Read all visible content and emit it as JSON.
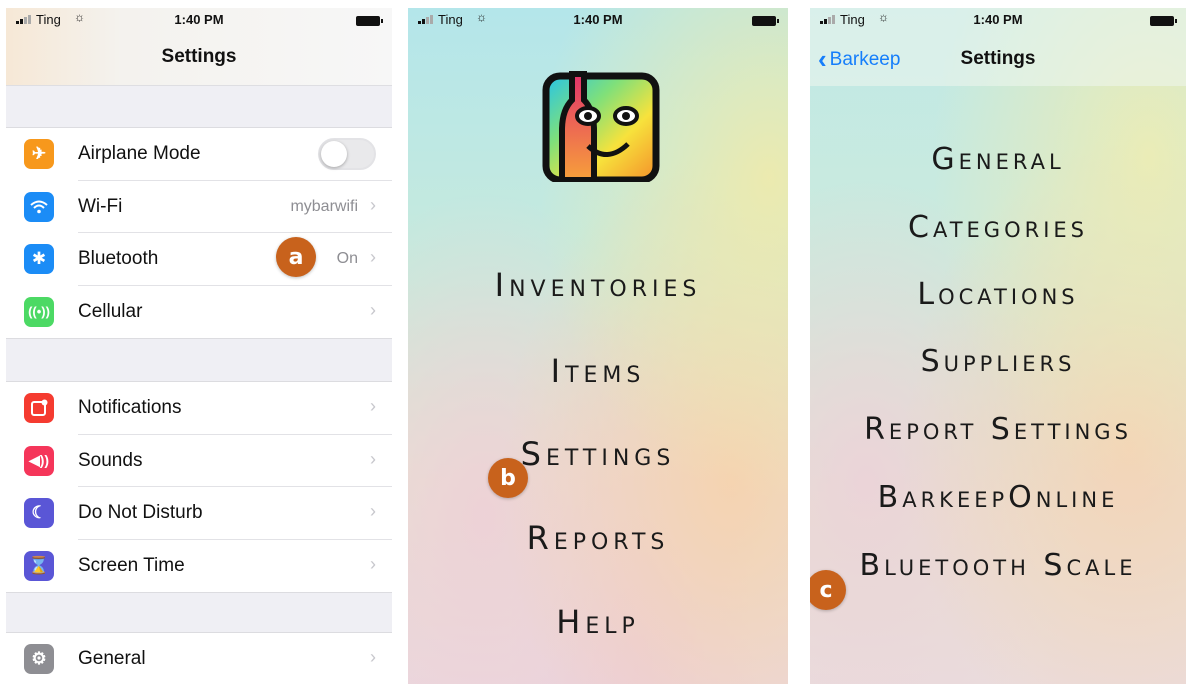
{
  "status_bar": {
    "carrier": "Ting",
    "time": "1:40 PM"
  },
  "ios_settings": {
    "title": "Settings",
    "group1": [
      {
        "label": "Airplane Mode",
        "value": "",
        "icon": "airplane-icon",
        "color": "#f7981c"
      },
      {
        "label": "Wi-Fi",
        "value": "mybarwifi",
        "icon": "wifi-icon",
        "color": "#1b8cf6"
      },
      {
        "label": "Bluetooth",
        "value": "On",
        "icon": "bluetooth-icon",
        "color": "#1b8cf6"
      },
      {
        "label": "Cellular",
        "value": "",
        "icon": "antenna-icon",
        "color": "#4cd964"
      }
    ],
    "group2": [
      {
        "label": "Notifications",
        "icon": "notifications-icon",
        "color": "#f53b30"
      },
      {
        "label": "Sounds",
        "icon": "speaker-icon",
        "color": "#f5365a"
      },
      {
        "label": "Do Not Disturb",
        "icon": "moon-icon",
        "color": "#5a56d6"
      },
      {
        "label": "Screen Time",
        "icon": "hourglass-icon",
        "color": "#5a56d6"
      }
    ],
    "group3": [
      {
        "label": "General",
        "icon": "gear-icon",
        "color": "#8e8e93"
      }
    ],
    "airplane_mode_on": false
  },
  "callouts": {
    "a": "a",
    "b": "b",
    "c": "c"
  },
  "barkeep_home": {
    "menu": [
      "Inventories",
      "Items",
      "Settings",
      "Reports",
      "Help"
    ]
  },
  "barkeep_settings": {
    "back_label": "Barkeep",
    "title": "Settings",
    "menu": [
      "General",
      "Categories",
      "Locations",
      "Suppliers",
      "Report Settings",
      "BarkeepOnline",
      "Bluetooth Scale"
    ]
  }
}
